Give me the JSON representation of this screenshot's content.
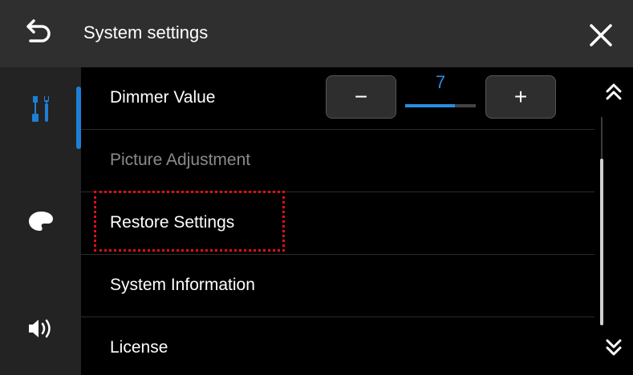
{
  "header": {
    "title": "System settings",
    "back_icon": "back-arrow-icon",
    "close_icon": "close-icon"
  },
  "sidebar": {
    "items": [
      {
        "icon": "tools-icon",
        "active": true
      },
      {
        "icon": "palette-icon",
        "active": false
      },
      {
        "icon": "speaker-icon",
        "active": false
      }
    ],
    "accent_color": "#1e7fd6"
  },
  "settings": {
    "rows": [
      {
        "label": "Dimmer Value"
      },
      {
        "label": "Picture Adjustment",
        "disabled": true
      },
      {
        "label": "Restore Settings",
        "highlighted": true
      },
      {
        "label": "System Information"
      },
      {
        "label": "License"
      }
    ],
    "dimmer": {
      "value": "7",
      "level_fraction": 0.7,
      "minus_label": "−",
      "plus_label": "+"
    }
  },
  "scrollbar": {
    "up_icon": "double-chevron-up-icon",
    "down_icon": "double-chevron-down-icon"
  },
  "colors": {
    "highlight": "#e01010",
    "value": "#2b8de0"
  }
}
